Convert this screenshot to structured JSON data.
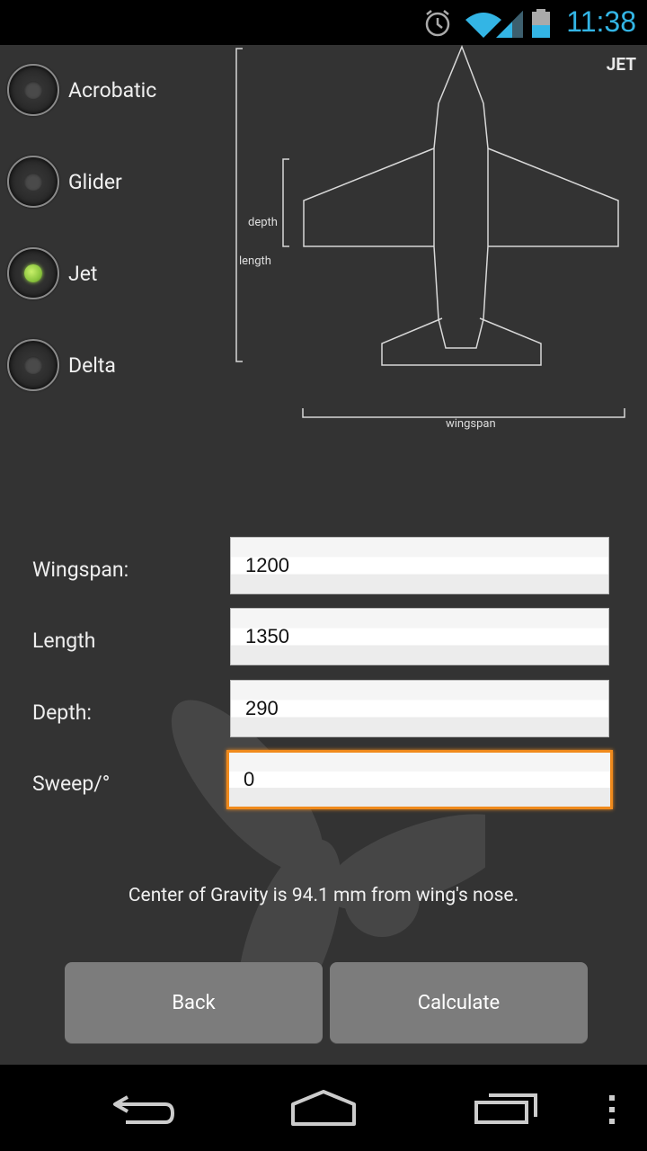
{
  "status": {
    "time": "11:38"
  },
  "radios": [
    {
      "label": "Acrobatic",
      "selected": false
    },
    {
      "label": "Glider",
      "selected": false
    },
    {
      "label": "Jet",
      "selected": true
    },
    {
      "label": "Delta",
      "selected": false
    }
  ],
  "diagram": {
    "tag": "JET",
    "depth_label": "depth",
    "length_label": "length",
    "wingspan_label": "wingspan"
  },
  "fields": {
    "wingspan": {
      "label": "Wingspan:",
      "value": "1200"
    },
    "length": {
      "label": "Length",
      "value": "1350"
    },
    "depth": {
      "label": "Depth:",
      "value": "290"
    },
    "sweep": {
      "label": "Sweep/°",
      "value": "0"
    }
  },
  "result_text": "Center of Gravity is 94.1 mm from wing's nose.",
  "buttons": {
    "back": "Back",
    "calculate": "Calculate"
  },
  "colors": {
    "accent": "#33b5e5",
    "focus": "#f08a1c",
    "selected": "#8cc63f"
  }
}
